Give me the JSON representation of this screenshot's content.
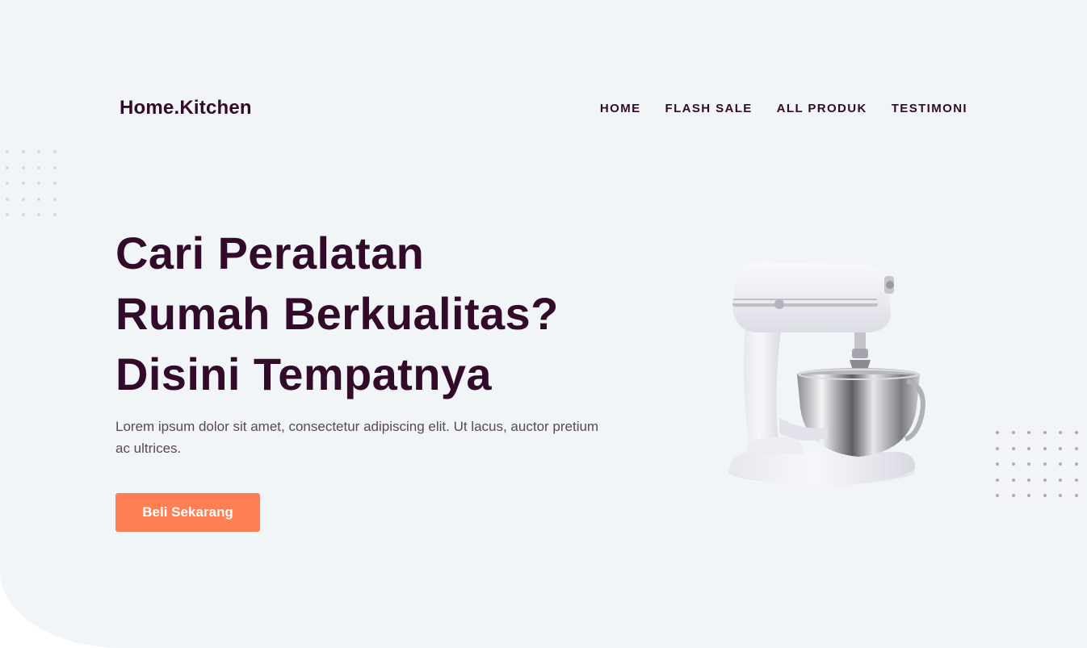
{
  "brand": {
    "name": "Home.Kitchen"
  },
  "nav": {
    "items": [
      {
        "label": "HOME"
      },
      {
        "label": "FLASH SALE"
      },
      {
        "label": "ALL PRODUK"
      },
      {
        "label": "TESTIMONI"
      }
    ]
  },
  "hero": {
    "headline_lines": [
      "Cari Peralatan",
      "Rumah Berkualitas?",
      "Disini Tempatnya"
    ],
    "description": "Lorem ipsum dolor sit amet, consectetur adipiscing elit. Ut lacus, auctor pretium ac ultrices.",
    "cta_label": "Beli Sekarang",
    "product_image": "stand-mixer-image"
  },
  "colors": {
    "background": "#f2f5f8",
    "primary_text": "#320b2b",
    "accent": "#fe7f53",
    "body_text": "#5b4757",
    "dots_left": "#d4d9df",
    "dots_right": "#c4a49b"
  }
}
